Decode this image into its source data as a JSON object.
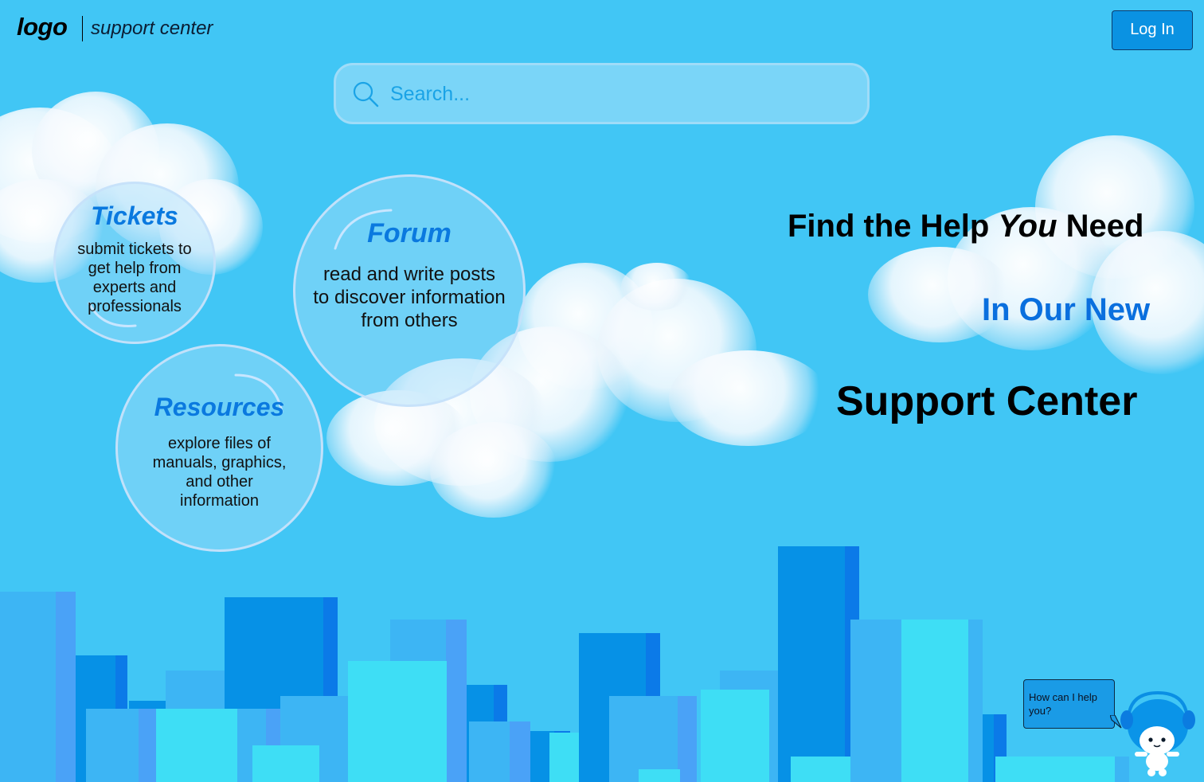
{
  "header": {
    "logo_text": "logo",
    "brand_subtitle": "support center",
    "login_label": "Log In"
  },
  "search": {
    "placeholder": "Search..."
  },
  "features": {
    "tickets": {
      "title": "Tickets",
      "description": "submit tickets to get help from experts and professionals"
    },
    "forum": {
      "title": "Forum",
      "description": "read and write posts to discover information from others"
    },
    "resources": {
      "title": "Resources",
      "description": "explore files of manuals, graphics, and other information"
    }
  },
  "hero": {
    "line1_before": "Find the Help ",
    "line1_emphasis": "You",
    "line1_after": " Need",
    "line2": "In Our New",
    "line3": "Support Center"
  },
  "chatbot": {
    "prompt": "How can I help you?"
  },
  "colors": {
    "sky": "#41c6f5",
    "accent": "#0a79df",
    "button": "#0a92e2"
  }
}
